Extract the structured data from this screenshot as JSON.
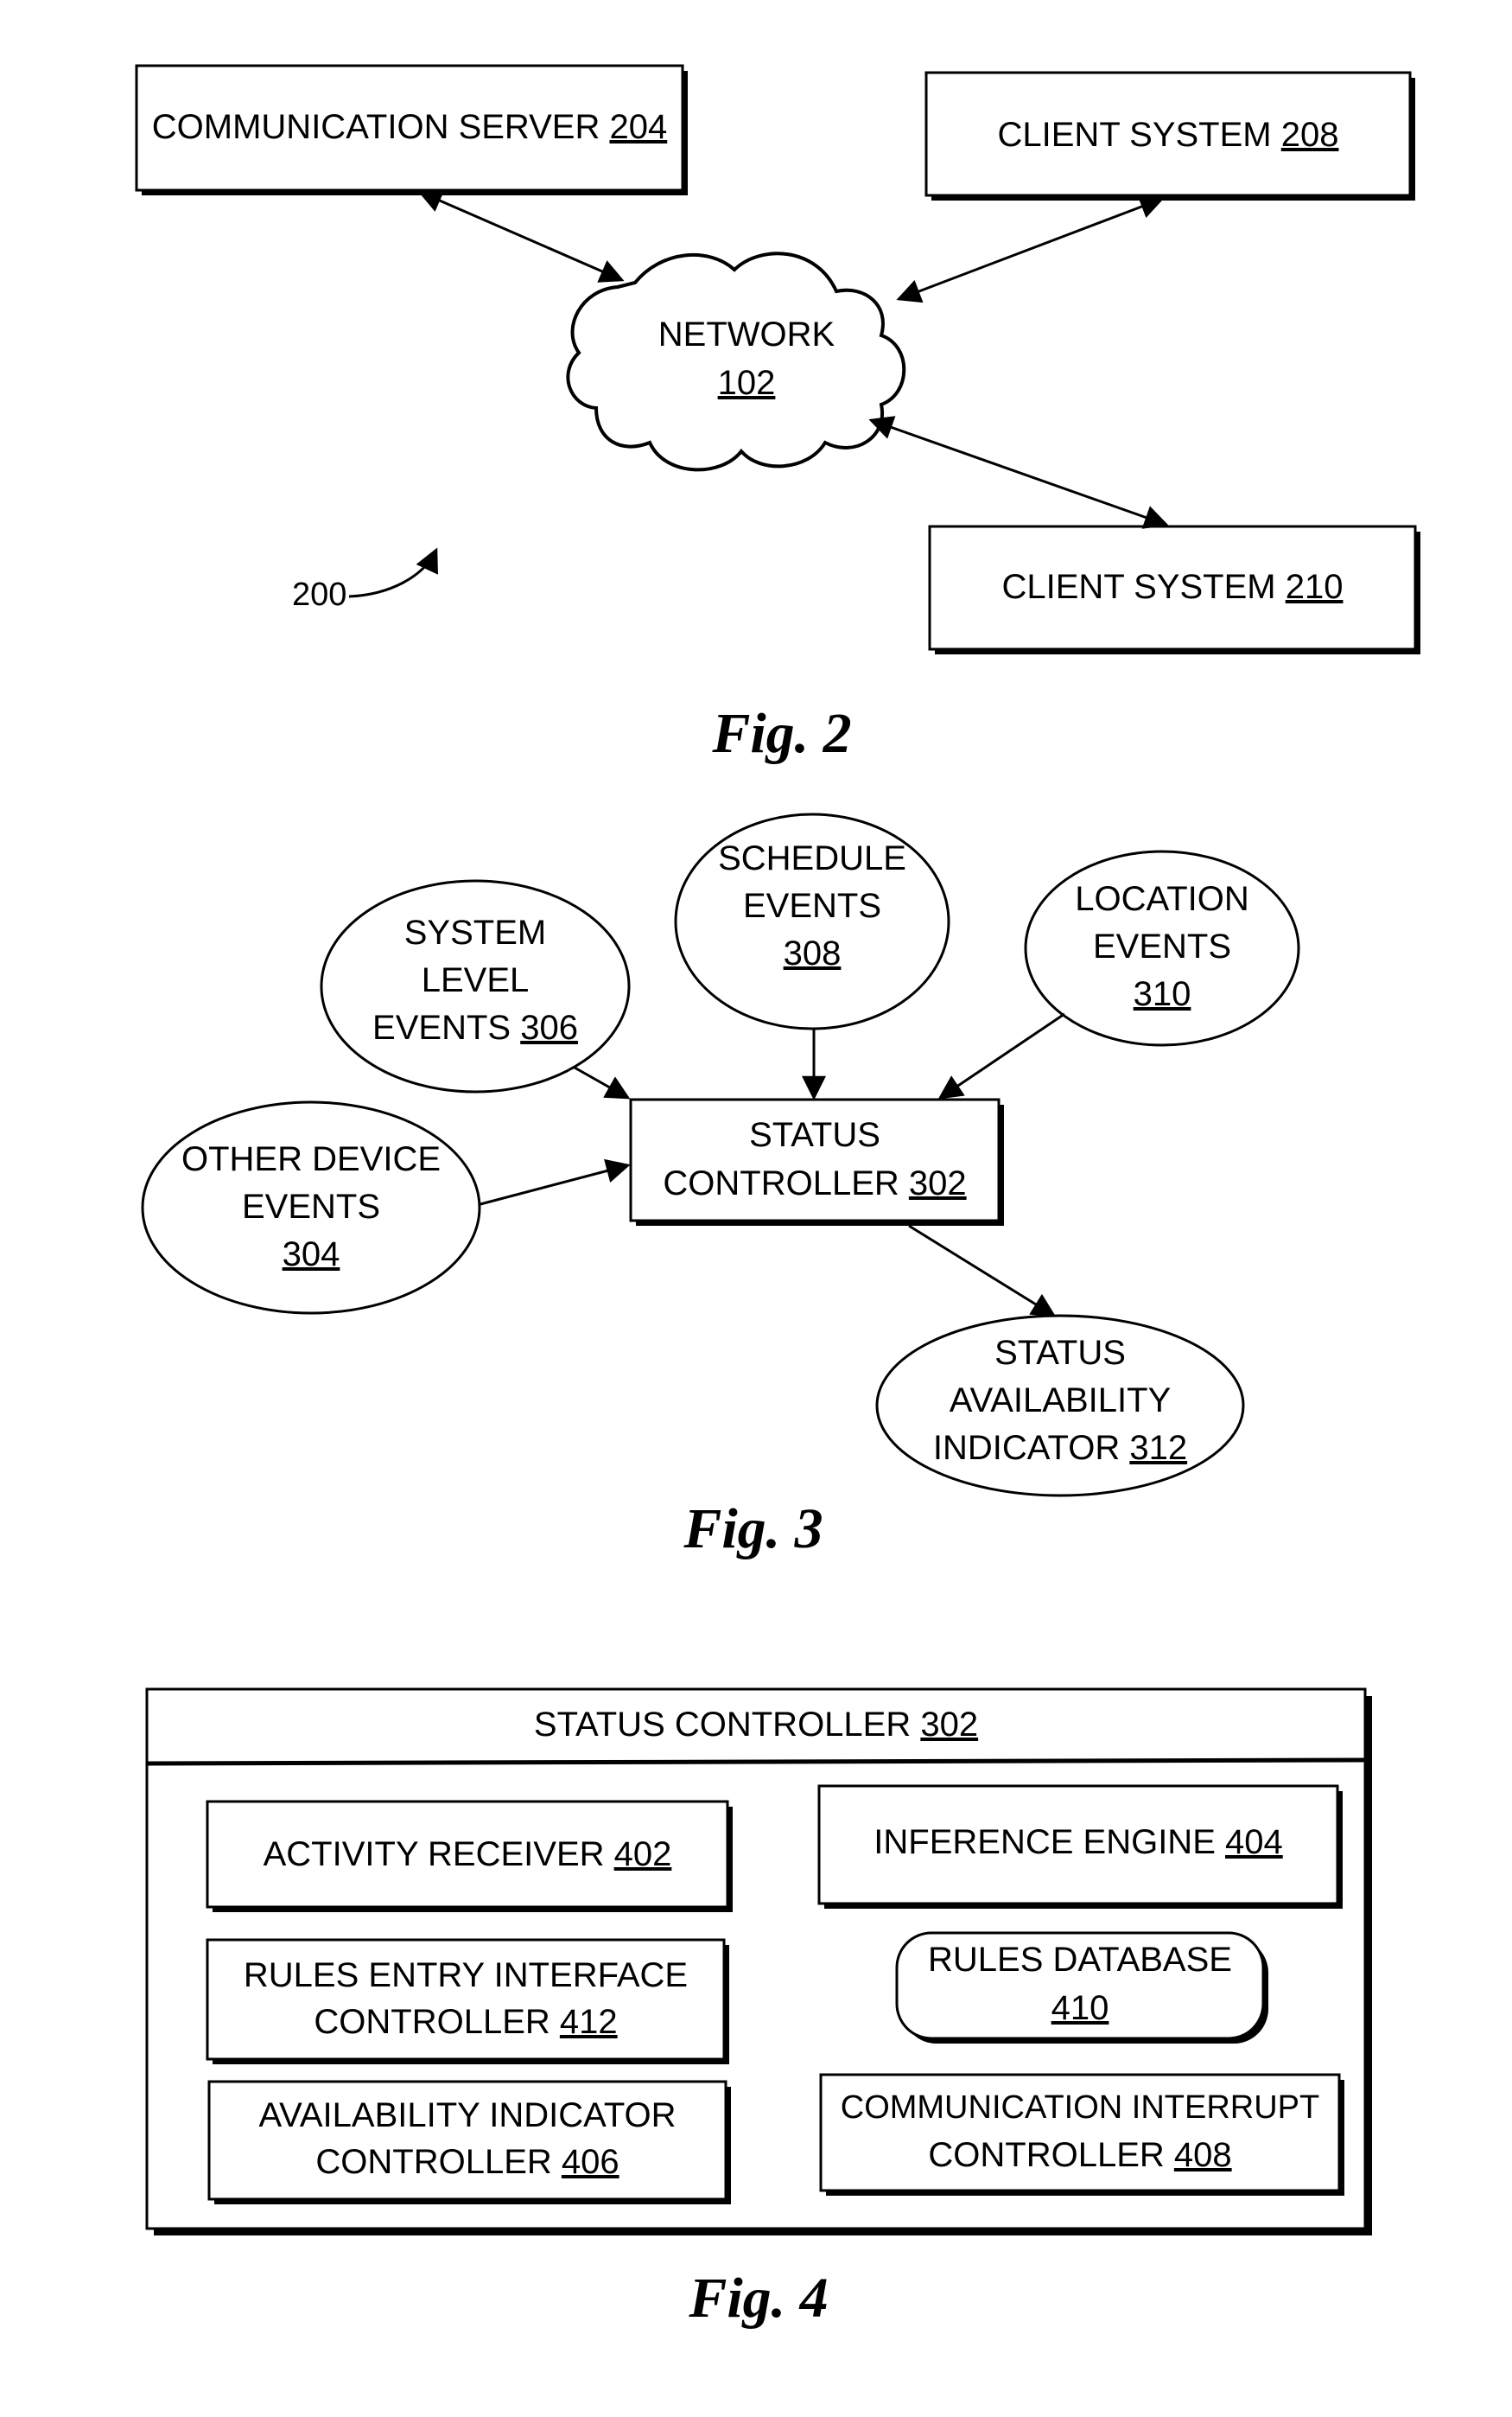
{
  "fig2": {
    "caption": "Fig. 2",
    "reference": "200",
    "nodes": {
      "comm_server": {
        "text": "COMMUNICATION SERVER ",
        "ref": "204"
      },
      "client_208": {
        "text": "CLIENT SYSTEM ",
        "ref": "208"
      },
      "network": {
        "text": "NETWORK",
        "ref": "102"
      },
      "client_210": {
        "text": "CLIENT SYSTEM ",
        "ref": "210"
      }
    },
    "edges": [
      {
        "from": "comm_server",
        "to": "network",
        "direction": "bidirectional"
      },
      {
        "from": "client_208",
        "to": "network",
        "direction": "bidirectional"
      },
      {
        "from": "client_210",
        "to": "network",
        "direction": "bidirectional"
      }
    ]
  },
  "fig3": {
    "caption": "Fig. 3",
    "nodes": {
      "system_level": {
        "lines": [
          "SYSTEM",
          "LEVEL",
          "EVENTS "
        ],
        "ref": "306"
      },
      "schedule": {
        "lines": [
          "SCHEDULE",
          "EVENTS"
        ],
        "ref": "308"
      },
      "location": {
        "lines": [
          "LOCATION",
          "EVENTS"
        ],
        "ref": "310"
      },
      "other_device": {
        "lines": [
          "OTHER DEVICE",
          "EVENTS"
        ],
        "ref": "304"
      },
      "status_controller": {
        "lines": [
          "STATUS",
          "CONTROLLER "
        ],
        "ref": "302"
      },
      "status_indicator": {
        "lines": [
          "STATUS",
          "AVAILABILITY",
          "INDICATOR "
        ],
        "ref": "312"
      }
    },
    "edges": [
      {
        "from": "system_level",
        "to": "status_controller"
      },
      {
        "from": "schedule",
        "to": "status_controller"
      },
      {
        "from": "location",
        "to": "status_controller"
      },
      {
        "from": "other_device",
        "to": "status_controller"
      },
      {
        "from": "status_controller",
        "to": "status_indicator"
      }
    ]
  },
  "fig4": {
    "caption": "Fig. 4",
    "container": {
      "text": "STATUS CONTROLLER ",
      "ref": "302"
    },
    "components": {
      "activity_receiver": {
        "lines": [
          "ACTIVITY RECEIVER "
        ],
        "ref": "402"
      },
      "inference_engine": {
        "lines": [
          "INFERENCE ENGINE "
        ],
        "ref": "404"
      },
      "rules_entry": {
        "lines": [
          "RULES ENTRY INTERFACE",
          "CONTROLLER "
        ],
        "ref": "412"
      },
      "rules_database": {
        "lines": [
          "RULES DATABASE"
        ],
        "ref": "410"
      },
      "availability_indicator": {
        "lines": [
          "AVAILABILITY INDICATOR",
          "CONTROLLER "
        ],
        "ref": "406"
      },
      "communication_interrupt": {
        "lines": [
          "COMMUNICATION INTERRUPT",
          "CONTROLLER "
        ],
        "ref": "408"
      }
    }
  }
}
